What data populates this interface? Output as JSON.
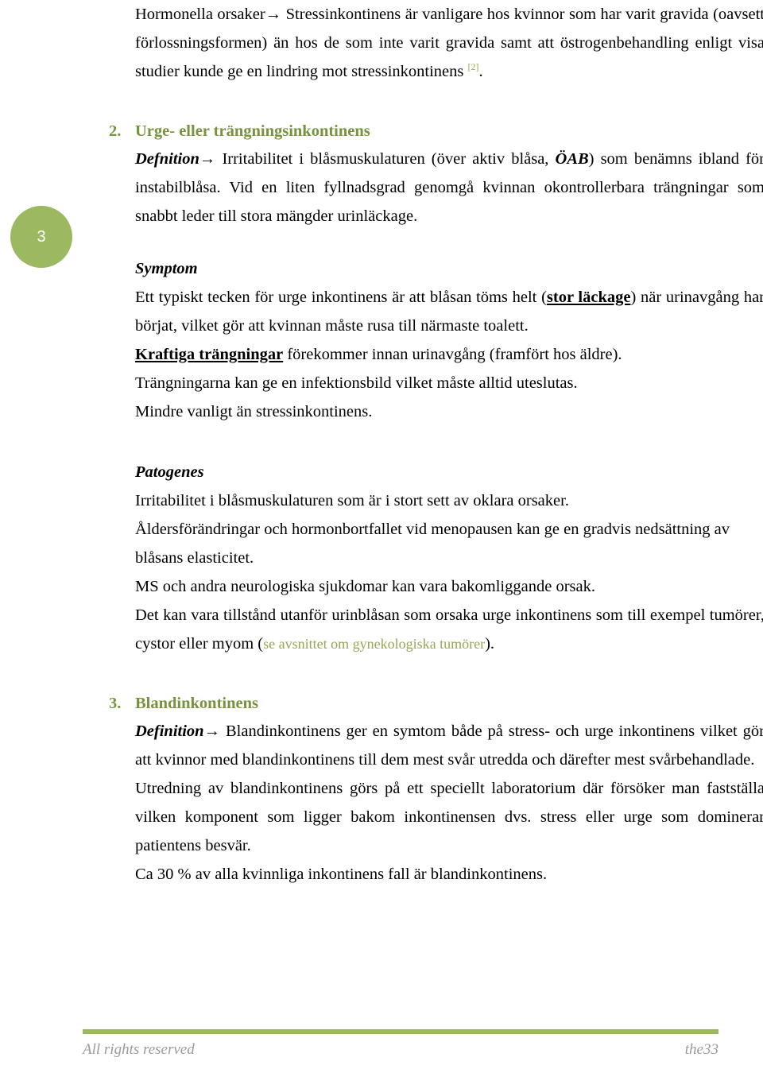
{
  "document": {
    "page_number": "3",
    "intro_paragraph": {
      "lead_term": "Hormonella orsaker",
      "arrow": "→",
      "text": " Stressinkontinens är vanligare hos kvinnor som har varit gravida (oavsett förlossningsformen) än hos de som inte varit gravida samt att östrogenbehandling enligt visa studier kunde ge en lindring mot stressinkontinens ",
      "reference_marker": "[2]",
      "trailing": "."
    },
    "sections": [
      {
        "number": "2.",
        "title": "Urge- eller trängningsinkontinens",
        "definition": {
          "label": "Defnition",
          "arrow": "→",
          "text_before_abbr": " Irritabilitet i blåsmuskulaturen (över aktiv blåsa, ",
          "abbr": "ÖAB",
          "text_after_abbr": ") som benämns ibland för instabilblåsa. Vid en liten fyllnadsgrad genomgå kvinnan okontrollerbara trängningar som snabbt leder till stora mängder urinläckage."
        },
        "subsections": [
          {
            "heading": "Symptom",
            "paragraphs": [
              {
                "pre": "Ett typiskt tecken för urge inkontinens är att blåsan töms helt (",
                "emphasis": "stor läckage",
                "post": ") när urinavgång har börjat, vilket gör att kvinnan måste rusa till närmaste toalett."
              },
              {
                "pre": "",
                "emphasis": "Kraftiga trängningar",
                "post": " förekommer innan urinavgång (framfört hos äldre)."
              },
              {
                "pre": "Trängningarna kan ge en infektionsbild vilket måste alltid uteslutas.",
                "emphasis": "",
                "post": ""
              },
              {
                "pre": "Mindre vanligt än stressinkontinens.",
                "emphasis": "",
                "post": ""
              }
            ]
          },
          {
            "heading": "Patogenes",
            "paragraphs": [
              {
                "pre": "Irritabilitet i blåsmuskulaturen som är i stort sett av oklara orsaker.",
                "emphasis": "",
                "post": ""
              },
              {
                "pre": "Åldersförändringar och hormonbortfallet vid menopausen kan ge en gradvis nedsättning av blåsans elasticitet.",
                "emphasis": "",
                "post": ""
              },
              {
                "pre": "MS och andra neurologiska sjukdomar kan vara bakomliggande orsak.",
                "emphasis": "",
                "post": ""
              },
              {
                "pre": "Det kan vara tillstånd utanför urinblåsan som orsaka urge inkontinens som till exempel tumörer, cystor eller myom (",
                "link": "se avsnittet om gynekologiska tumörer",
                "post": ")."
              }
            ]
          }
        ]
      },
      {
        "number": "3.",
        "title": "Blandinkontinens",
        "definition": {
          "label": "Definition",
          "arrow": "→",
          "text": " Blandinkontinens ger en symtom både på stress- och urge inkontinens vilket gör att kvinnor med blandinkontinens till dem mest svår utredda och därefter mest svårbehandlade."
        },
        "paragraphs": [
          "Utredning av blandinkontinens görs på ett speciellt laboratorium där försöker man fastställa vilken komponent som ligger bakom inkontinensen dvs. stress eller urge som dominerar patientens besvär.",
          "Ca 30 % av alla kvinnliga inkontinens fall är blandinkontinens."
        ]
      }
    ]
  },
  "footer": {
    "left": "All rights reserved",
    "right": "the33"
  },
  "colors": {
    "accent_green": "#9cb860",
    "heading_green": "#77933c",
    "link_green": "#94a855",
    "footer_gray": "#9a9a9a"
  }
}
